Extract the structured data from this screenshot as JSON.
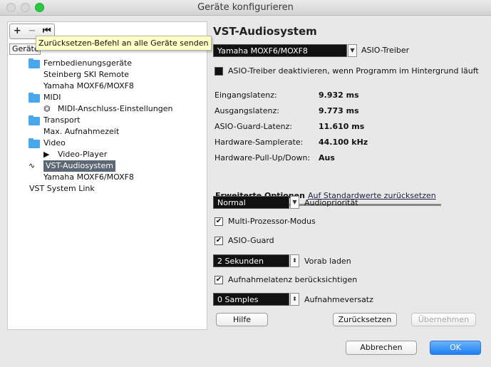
{
  "window": {
    "title": "Geräte konfigurieren"
  },
  "toolbar": {
    "add": "+",
    "remove": "−",
    "reset": "⏮"
  },
  "tree": {
    "header": "Geräte",
    "tooltip": "Zurücksetzen-Befehl an alle Geräte senden",
    "items": [
      {
        "label": "Fernbedienungsgeräte"
      },
      {
        "label": "Steinberg SKI Remote"
      },
      {
        "label": "Yamaha MOXF6/MOXF8"
      },
      {
        "label": "MIDI"
      },
      {
        "label": "MIDI-Anschluss-Einstellungen"
      },
      {
        "label": "Transport"
      },
      {
        "label": "Max. Aufnahmezeit"
      },
      {
        "label": "Video"
      },
      {
        "label": "Video-Player"
      },
      {
        "label": "VST-Audiosystem"
      },
      {
        "label": "Yamaha MOXF6/MOXF8"
      },
      {
        "label": "VST System Link"
      }
    ]
  },
  "panel": {
    "title": "VST-Audiosystem",
    "driver_value": "Yamaha MOXF6/MOXF8",
    "driver_label": "ASIO-Treiber",
    "deactivate_label": "ASIO-Treiber deaktivieren, wenn Programm im Hintergrund läuft",
    "info": [
      {
        "label": "Eingangslatenz:",
        "value": "9.932 ms"
      },
      {
        "label": "Ausgangslatenz:",
        "value": "9.773 ms"
      },
      {
        "label": "ASIO-Guard-Latenz:",
        "value": "11.610 ms"
      },
      {
        "label": "Hardware-Samplerate:",
        "value": "44.100 kHz"
      },
      {
        "label": "Hardware-Pull-Up/Down:",
        "value": "Aus"
      }
    ],
    "tab_advanced": "Erweiterte Optionen",
    "tab_reset_defaults": "Auf Standardwerte zurücksetzen",
    "priority_value": "Normal",
    "priority_label": "Audiopriorität",
    "multiproc_label": "Multi-Prozessor-Modus",
    "asioguard_label": "ASIO-Guard",
    "preload_value": "2 Sekunden",
    "preload_label": "Vorab laden",
    "latency_label": "Aufnahmelatenz berücksichtigen",
    "offset_value": "0 Samples",
    "offset_label": "Aufnahmeversatz",
    "help": "Hilfe",
    "reset": "Zurücksetzen",
    "apply": "Übernehmen"
  },
  "footer": {
    "cancel": "Abbrechen",
    "ok": "OK"
  }
}
